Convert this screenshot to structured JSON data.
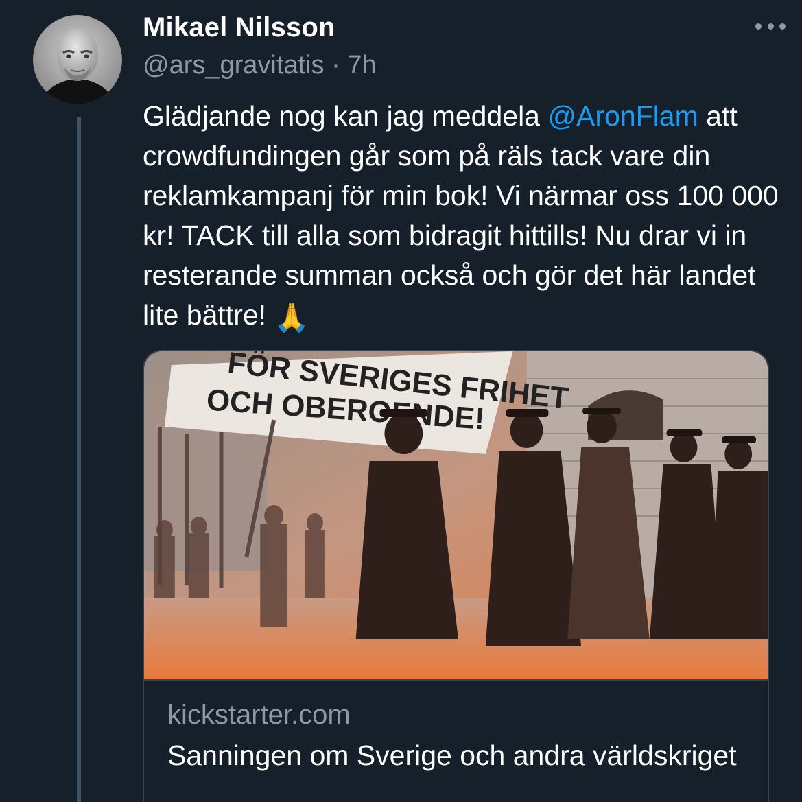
{
  "tweet": {
    "display_name": "Mikael Nilsson",
    "handle": "@ars_gravitatis",
    "separator": "·",
    "time": "7h",
    "text_before_mention": "Glädjande nog kan jag meddela ",
    "mention": "@AronFlam",
    "text_after_mention": " att crowdfundingen går som på räls tack vare din reklamkampanj för min bok! Vi närmar oss 100 000 kr! TACK till alla som bidragit hittills! Nu drar vi in resterande summan också och gör det här landet lite bättre! ",
    "emoji": "🙏",
    "more_icon": "more-horizontal-icon"
  },
  "card": {
    "banner_line1": "FÖR SVERIGES FRIHET",
    "banner_line2": "OCH OBEROENDE!",
    "domain": "kickstarter.com",
    "title": "Sanningen om Sverige och andra världskriget"
  },
  "colors": {
    "background": "#15202b",
    "text": "#ffffff",
    "secondary": "#8b98a5",
    "link": "#1d9bf0",
    "border": "#38444d",
    "thread_line": "#3d5466",
    "image_tint": "#e8763a"
  }
}
